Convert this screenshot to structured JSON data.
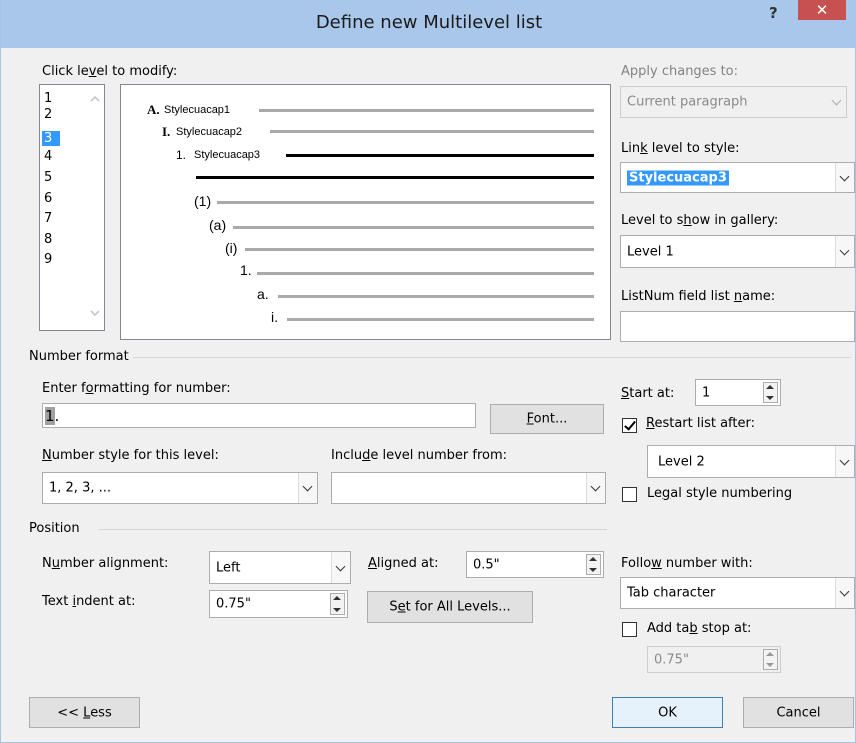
{
  "window": {
    "title": "Define new Multilevel list",
    "help_glyph": "?",
    "close_glyph": "✕"
  },
  "level_section": {
    "label_pre": "Click le",
    "label_key": "v",
    "label_post": "el to modify:",
    "levels": [
      "1",
      "2",
      "3",
      "4",
      "5",
      "6",
      "7",
      "8",
      "9"
    ],
    "selected_level": "3"
  },
  "preview": {
    "rows": [
      {
        "num": "A.",
        "text": "Stylecuacap1"
      },
      {
        "num": "I.",
        "text": "Stylecuacap2"
      },
      {
        "num": "1.",
        "text": "Stylecuacap3"
      },
      {
        "num": "",
        "text": ""
      },
      {
        "num": "(1)",
        "text": ""
      },
      {
        "num": "(a)",
        "text": ""
      },
      {
        "num": "(i)",
        "text": ""
      },
      {
        "num": "1.",
        "text": ""
      },
      {
        "num": "a.",
        "text": ""
      },
      {
        "num": "i.",
        "text": ""
      }
    ]
  },
  "apply_changes": {
    "label": "Apply changes to:",
    "value": "Current paragraph"
  },
  "link_level": {
    "label_pre": "Lin",
    "label_key": "k",
    "label_post": " level to style:",
    "value": "Stylecuacap3"
  },
  "level_gallery": {
    "label_pre": "Level to s",
    "label_key": "h",
    "label_post": "ow in gallery:",
    "value": "Level 1"
  },
  "listnum": {
    "label_pre": "ListNum field list ",
    "label_key": "n",
    "label_post": "ame:",
    "value": ""
  },
  "number_format": {
    "group_label": "Number format",
    "enter_label_pre": "Enter f",
    "enter_label_key": "o",
    "enter_label_post": "rmatting for number:",
    "format_highlight": "1",
    "format_rest": ".",
    "font_button_key": "F",
    "font_button_rest": "ont...",
    "style_label_key": "N",
    "style_label_rest": "umber style for this level:",
    "style_value": "1, 2, 3, ...",
    "include_label_pre": "Inclu",
    "include_label_key": "d",
    "include_label_post": "e level number from:",
    "include_value": "",
    "start_label_pre": "",
    "start_label_key": "S",
    "start_label_post": "tart at:",
    "start_value": "1",
    "restart_label_key": "R",
    "restart_label_rest": "estart list after:",
    "restart_checked": true,
    "restart_value": "Level 2",
    "legal_label_pre": "Le",
    "legal_label_key": "g",
    "legal_label_post": "al style numbering",
    "legal_checked": false
  },
  "position": {
    "group_label": "Position",
    "alignment_label_pre": "N",
    "alignment_label_key": "u",
    "alignment_label_post": "mber alignment:",
    "alignment_value": "Left",
    "aligned_at_label_key": "A",
    "aligned_at_label_rest": "ligned at:",
    "aligned_at_value": "0.5\"",
    "indent_label_pre": "Text ",
    "indent_label_key": "i",
    "indent_label_post": "ndent at:",
    "indent_value": "0.75\"",
    "set_all_pre": "S",
    "set_all_key": "e",
    "set_all_post": "t for All Levels...",
    "follow_label_pre": "Follo",
    "follow_label_key": "w",
    "follow_label_post": " number with:",
    "follow_value": "Tab character",
    "tabstop_label_pre": "Add ta",
    "tabstop_label_key": "b",
    "tabstop_label_post": " stop at:",
    "tabstop_checked": false,
    "tabstop_value": "0.75\""
  },
  "footer": {
    "less_pre": "<< ",
    "less_key": "L",
    "less_post": "ess",
    "ok": "OK",
    "cancel": "Cancel"
  },
  "colors": {
    "titlebar": "#a8c7ea",
    "close": "#c75050",
    "selection": "#3399ff",
    "dialog_bg": "#f0f0f0"
  }
}
